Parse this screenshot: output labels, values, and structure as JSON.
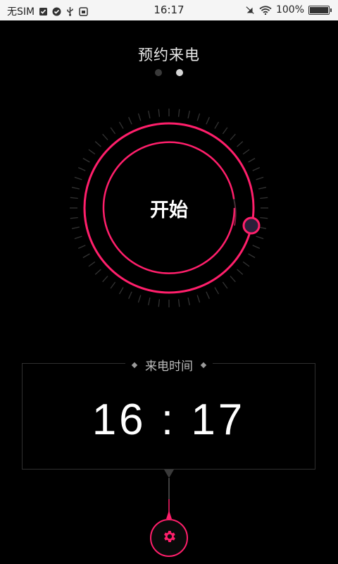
{
  "status_bar": {
    "carrier": "无SIM",
    "time": "16:17",
    "battery": "100%",
    "battery_level": 1.0,
    "icons": [
      "clipboard-check-icon",
      "shield-check-icon",
      "usb-icon",
      "app-notification-icon",
      "mute-icon",
      "wifi-icon",
      "battery-icon"
    ]
  },
  "page": {
    "title": "预约来电",
    "pages_total": 2,
    "current_page": 2
  },
  "dial": {
    "center_label": "开始",
    "accent_color": "#ff1f6b"
  },
  "call_time": {
    "label": "来电时间",
    "value": "16 : 17"
  },
  "settings": {
    "icon": "gear-icon"
  }
}
